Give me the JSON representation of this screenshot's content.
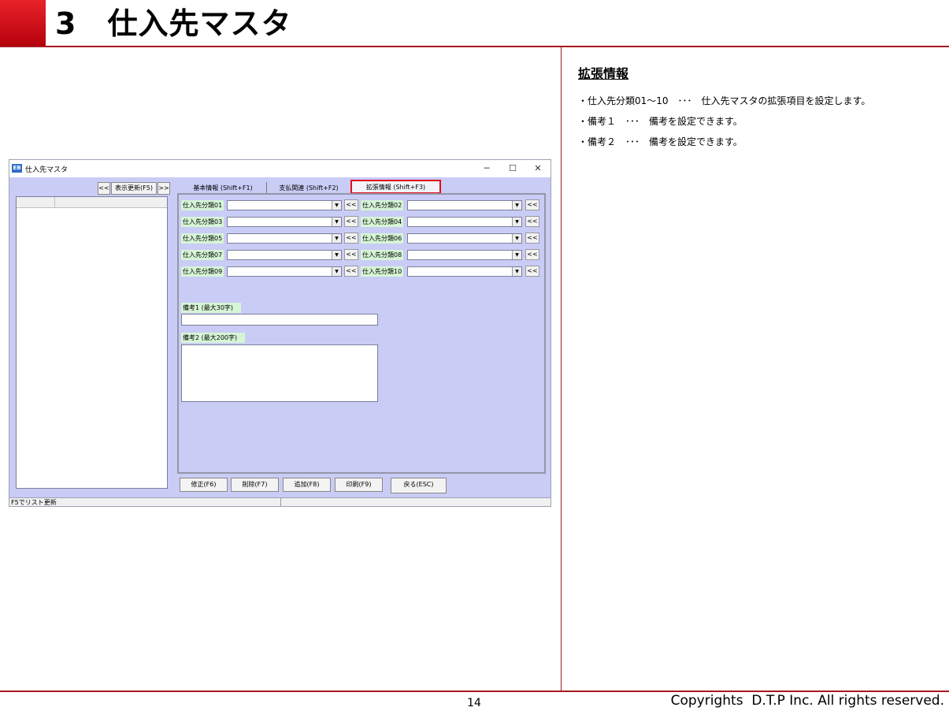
{
  "page": {
    "title": "3　仕入先マスタ",
    "page_number": "14",
    "copyright": "Copyrights  D.T.P Inc. All rights reserved.",
    "accent_color": "#a71a1e"
  },
  "ext_info": {
    "heading": "拡張情報",
    "lines": [
      "・仕入先分類01～10　･･･　仕入先マスタの拡張項目を設定します。",
      "・備考１　･･･　備考を設定できます。",
      "・備考２　･･･　備考を設定できます。"
    ]
  },
  "window": {
    "title": "仕入先マスタ",
    "controls": {
      "minimize": "─",
      "maximize": "☐",
      "close": "✕"
    },
    "list_nav": {
      "prev": "<<",
      "refresh": "表示更新(F5)",
      "next": ">>"
    },
    "tabs": [
      "基本情報 (Shift+F1)",
      "支払関連 (Shift+F2)",
      "拡張情報 (Shift+F3)"
    ],
    "active_tab": "拡張情報 (Shift+F3)",
    "fields": [
      {
        "label": "仕入先分類01",
        "value": ""
      },
      {
        "label": "仕入先分類02",
        "value": ""
      },
      {
        "label": "仕入先分類03",
        "value": ""
      },
      {
        "label": "仕入先分類04",
        "value": ""
      },
      {
        "label": "仕入先分類05",
        "value": ""
      },
      {
        "label": "仕入先分類06",
        "value": ""
      },
      {
        "label": "仕入先分類07",
        "value": ""
      },
      {
        "label": "仕入先分類08",
        "value": ""
      },
      {
        "label": "仕入先分類09",
        "value": ""
      },
      {
        "label": "仕入先分類10",
        "value": ""
      }
    ],
    "field_button": "<<",
    "combo_arrow": "▼",
    "memo1_label": "備考1 (最大30字)",
    "memo2_label": "備考2 (最大200字)",
    "buttons": {
      "modify": "修正(F6)",
      "delete": "削除(F7)",
      "add": "追加(F8)",
      "print": "印刷(F9)",
      "back": "戻る(ESC)"
    },
    "status_text": "F5でリスト更新"
  }
}
